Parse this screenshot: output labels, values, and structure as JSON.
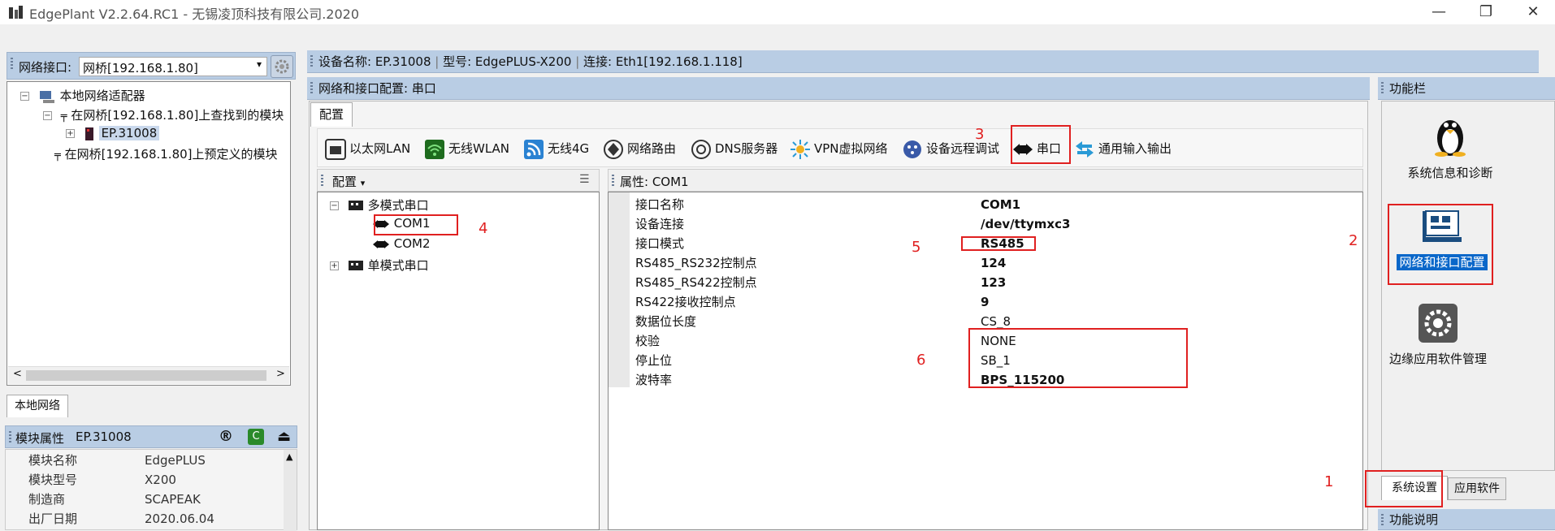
{
  "window": {
    "title": "EdgePlant V2.2.64.RC1 - 无锡凌顶科技有限公司.2020",
    "minimize": "—",
    "maximize": "❐",
    "close": "✕"
  },
  "left": {
    "iface_label": "网络接口:",
    "iface_value": "网桥[192.168.1.80]",
    "tree": {
      "root": "本地网络适配器",
      "found": "在网桥[192.168.1.80]上查找到的模块",
      "device": "EP.31008",
      "predefined": "在网桥[192.168.1.80]上预定义的模块"
    },
    "tab_local": "本地网络",
    "module_header_label": "模块属性",
    "module_header_value": "EP.31008",
    "module_props": [
      {
        "k": "模块名称",
        "v": "EdgePLUS"
      },
      {
        "k": "模块型号",
        "v": "X200"
      },
      {
        "k": "制造商",
        "v": "SCAPEAK"
      },
      {
        "k": "出厂日期",
        "v": "2020.06.04"
      }
    ]
  },
  "device_bar": {
    "name": "设备名称: EP.31008",
    "model": "型号: EdgePLUS-X200",
    "conn": "连接: Eth1[192.168.1.118]"
  },
  "section_title": "网络和接口配置: 串口",
  "config_tab": "配置",
  "toolbar": {
    "ethernet": "以太网LAN",
    "wlan": "无线WLAN",
    "g4": "无线4G",
    "route": "网络路由",
    "dns": "DNS服务器",
    "vpn": "VPN虚拟网络",
    "remote": "设备远程调试",
    "serial": "串口",
    "io": "通用输入输出"
  },
  "config_pane": {
    "dropdown": "配置",
    "multi": "多模式串口",
    "com1": "COM1",
    "com2": "COM2",
    "single": "单模式串口"
  },
  "props": {
    "header": "属性: COM1",
    "rows": [
      {
        "k": "接口名称",
        "v": "COM1"
      },
      {
        "k": "设备连接",
        "v": "/dev/ttymxc3"
      },
      {
        "k": "接口模式",
        "v": "RS485"
      },
      {
        "k": "RS485_RS232控制点",
        "v": "124"
      },
      {
        "k": "RS485_RS422控制点",
        "v": "123"
      },
      {
        "k": "RS422接收控制点",
        "v": "9"
      },
      {
        "k": "数据位长度",
        "v": "CS_8"
      },
      {
        "k": "校验",
        "v": "NONE"
      },
      {
        "k": "停止位",
        "v": "SB_1"
      },
      {
        "k": "波特率",
        "v": "BPS_115200"
      }
    ]
  },
  "right": {
    "header": "功能栏",
    "sysinfo": "系统信息和诊断",
    "netcfg": "网络和接口配置",
    "edge": "边缘应用软件管理",
    "tab_sys": "系统设置",
    "tab_app": "应用软件",
    "func_desc": "功能说明"
  },
  "annotations": [
    "1",
    "2",
    "3",
    "4",
    "5",
    "6"
  ]
}
